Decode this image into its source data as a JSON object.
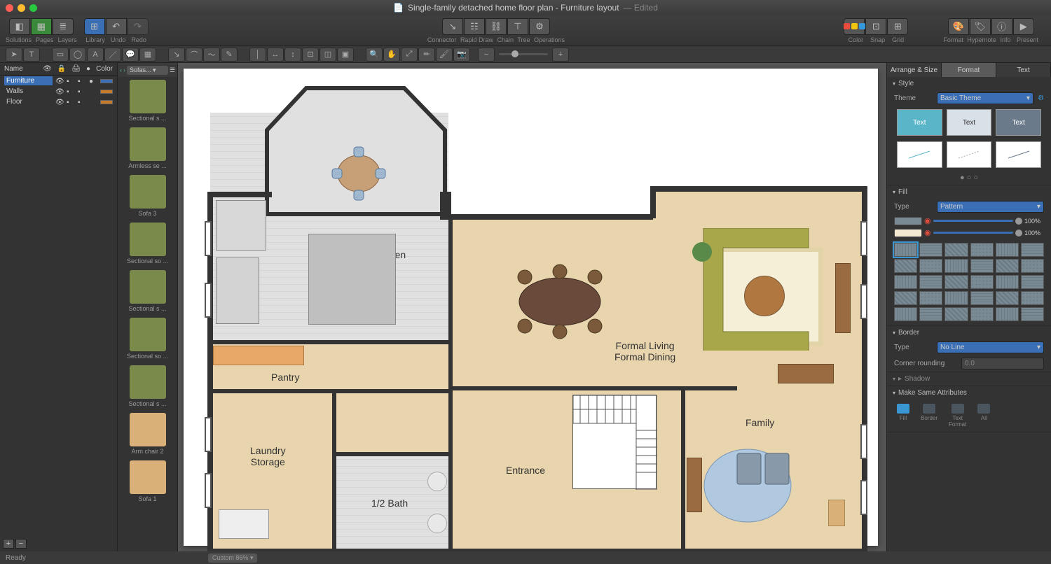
{
  "window": {
    "title": "Single-family detached home floor plan - Furniture layout",
    "edited": "— Edited"
  },
  "toolbar": {
    "solutions": "Solutions",
    "pages": "Pages",
    "layers": "Layers",
    "library": "Library",
    "undo": "Undo",
    "redo": "Redo",
    "connector": "Connector",
    "rapid_draw": "Rapid Draw",
    "chain": "Chain",
    "tree": "Tree",
    "operations": "Operations",
    "color": "Color",
    "snap": "Snap",
    "grid": "Grid",
    "format": "Format",
    "hypernote": "Hypernote",
    "info": "Info",
    "present": "Present"
  },
  "layers": {
    "name_header": "Name",
    "color_header": "Color",
    "items": [
      {
        "name": "Furniture",
        "color": "#3b6fb5",
        "selected": true
      },
      {
        "name": "Walls",
        "color": "#c97a28"
      },
      {
        "name": "Floor",
        "color": "#c97a28"
      }
    ]
  },
  "library": {
    "dropdown": "Sofas...",
    "items": [
      {
        "label": "Sectional s ..."
      },
      {
        "label": "Armless se ..."
      },
      {
        "label": "Sofa 3"
      },
      {
        "label": "Sectional so ..."
      },
      {
        "label": "Sectional s ..."
      },
      {
        "label": "Sectional so ..."
      },
      {
        "label": "Sectional s ..."
      },
      {
        "label": "Arm chair 2"
      },
      {
        "label": "Sofa 1"
      }
    ]
  },
  "rooms": {
    "kitchen": "Eat-in Kitchen",
    "pantry": "Pantry",
    "laundry": "Laundry\nStorage",
    "bath": "1/2 Bath",
    "entrance": "Entrance",
    "living": "Formal Living\nFormal Dining",
    "family": "Family"
  },
  "right_panel": {
    "tabs": {
      "arrange": "Arrange & Size",
      "format": "Format",
      "text": "Text"
    },
    "style": {
      "label": "Style",
      "theme_label": "Theme",
      "theme": "Basic Theme",
      "card": "Text"
    },
    "fill": {
      "label": "Fill",
      "type_label": "Type",
      "type": "Pattern",
      "pct": "100%"
    },
    "border": {
      "label": "Border",
      "type_label": "Type",
      "type": "No Line",
      "rounding_label": "Corner rounding",
      "rounding": "0.0"
    },
    "shadow": {
      "label": "Shadow"
    },
    "attrs": {
      "label": "Make Same Attributes",
      "fill": "Fill",
      "border": "Border",
      "text": "Text\nFormat",
      "all": "All"
    }
  },
  "status": {
    "ready": "Ready",
    "zoom": "Custom 86%"
  }
}
